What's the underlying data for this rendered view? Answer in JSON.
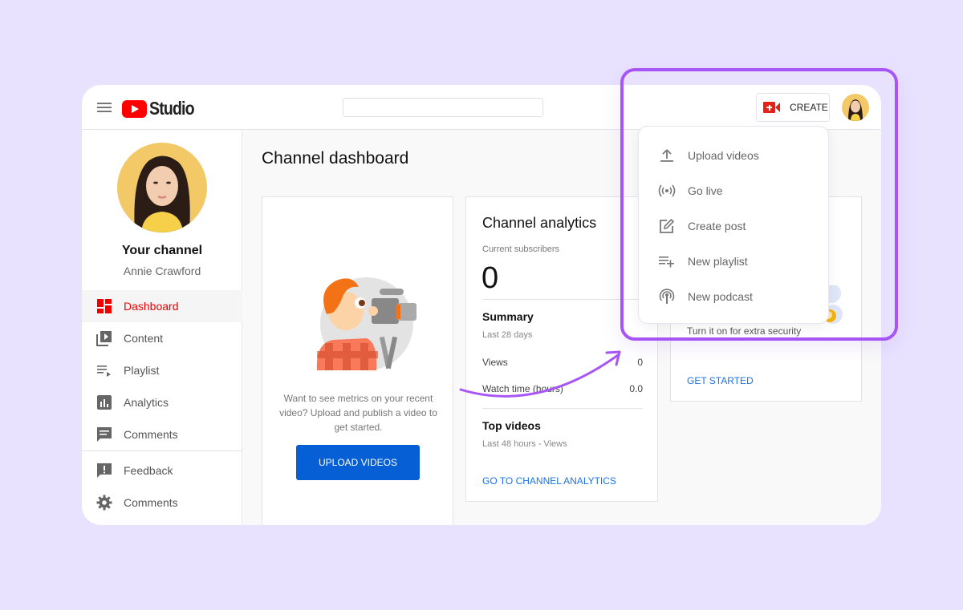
{
  "header": {
    "logo_text": "Studio",
    "search_placeholder": "",
    "create_label": "CREATE"
  },
  "sidebar": {
    "channel_title": "Your channel",
    "channel_name": "Annie Crawford",
    "items": [
      {
        "label": "Dashboard",
        "icon": "dashboard-icon",
        "active": true
      },
      {
        "label": "Content",
        "icon": "content-icon"
      },
      {
        "label": "Playlist",
        "icon": "playlist-icon"
      },
      {
        "label": "Analytics",
        "icon": "analytics-icon"
      },
      {
        "label": "Comments",
        "icon": "comments-icon"
      }
    ],
    "bottom_items": [
      {
        "label": "Feedback",
        "icon": "feedback-icon"
      },
      {
        "label": "Comments",
        "icon": "gear-icon"
      }
    ]
  },
  "main": {
    "title": "Channel dashboard",
    "upload_card": {
      "description": "Want to see metrics on your recent video? Upload and publish a video to get started.",
      "button": "UPLOAD VIDEOS"
    },
    "analytics_card": {
      "title": "Channel analytics",
      "subscribers_label": "Current subscribers",
      "subscribers_value": "0",
      "summary_title": "Summary",
      "summary_period": "Last 28 days",
      "rows": [
        {
          "label": "Views",
          "value": "0"
        },
        {
          "label": "Watch time (hours)",
          "value": "0.0"
        }
      ],
      "top_videos_title": "Top videos",
      "top_videos_period": "Last 48 hours - Views",
      "link": "GO TO CHANNEL ANALYTICS"
    },
    "security_card": {
      "text": "Turn it on for extra security",
      "link": "GET STARTED"
    }
  },
  "create_menu": {
    "items": [
      {
        "label": "Upload videos",
        "icon": "upload-icon"
      },
      {
        "label": "Go live",
        "icon": "live-icon"
      },
      {
        "label": "Create post",
        "icon": "create-post-icon"
      },
      {
        "label": "New playlist",
        "icon": "playlist-add-icon"
      },
      {
        "label": "New podcast",
        "icon": "podcast-icon"
      }
    ]
  },
  "colors": {
    "accent": "#a855f7",
    "brand": "#ff0000",
    "link": "#1a73e8",
    "button": "#065fd4",
    "background": "#e9e2ff"
  }
}
